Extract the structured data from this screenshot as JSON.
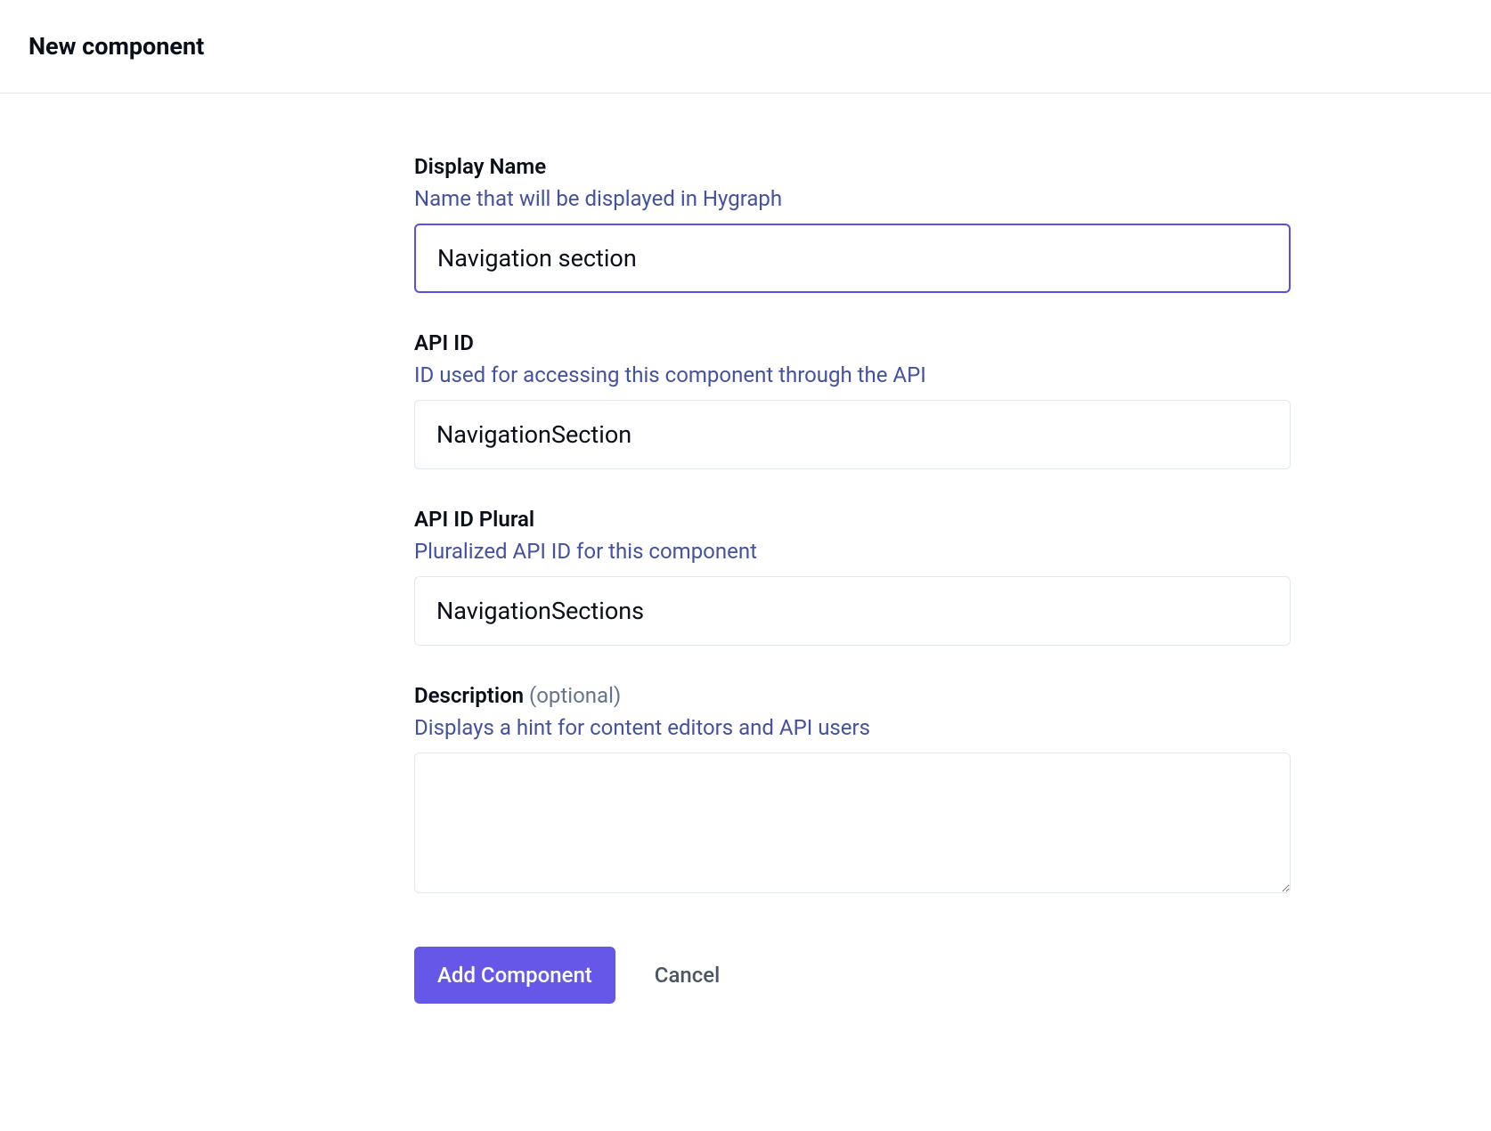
{
  "header": {
    "title": "New component"
  },
  "form": {
    "displayName": {
      "label": "Display Name",
      "help": "Name that will be displayed in Hygraph",
      "value": "Navigation section"
    },
    "apiId": {
      "label": "API ID",
      "help": "ID used for accessing this component through the API",
      "value": "NavigationSection"
    },
    "apiIdPlural": {
      "label": "API ID Plural",
      "help": "Pluralized API ID for this component",
      "value": "NavigationSections"
    },
    "description": {
      "label": "Description",
      "optional": "(optional)",
      "help": "Displays a hint for content editors and API users",
      "value": ""
    }
  },
  "actions": {
    "primary": "Add Component",
    "secondary": "Cancel"
  }
}
